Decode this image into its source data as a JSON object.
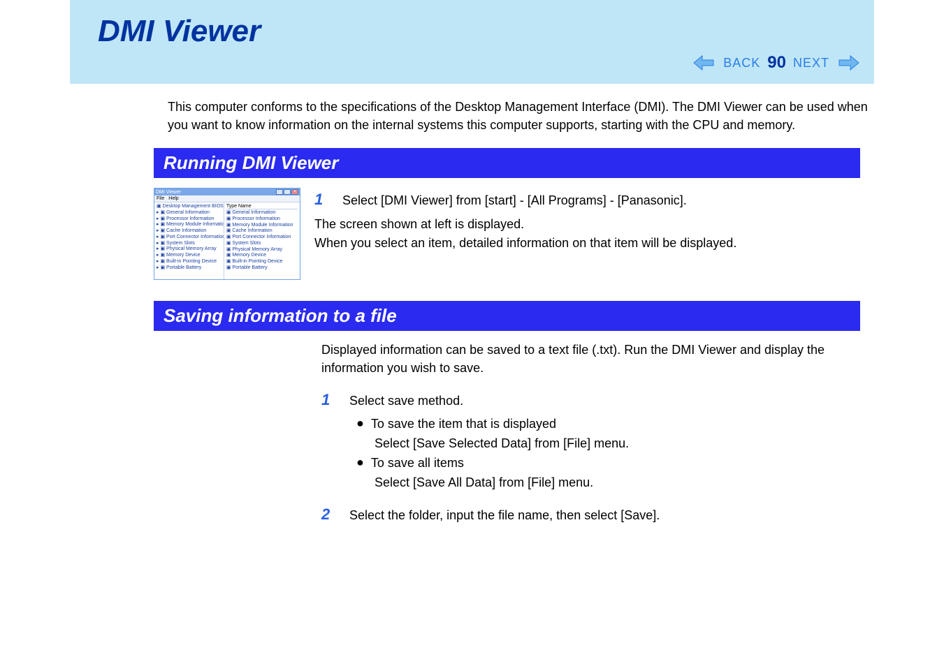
{
  "header": {
    "title": "DMI Viewer",
    "back_label": "BACK",
    "page_number": "90",
    "next_label": "NEXT"
  },
  "intro": "This computer conforms to the specifications of the Desktop Management Interface (DMI). The DMI Viewer can be used when you want to know information on the internal systems this computer supports, starting with the CPU and memory.",
  "section1": {
    "heading": "Running DMI Viewer",
    "step1_num": "1",
    "step1_text": "Select [DMI Viewer] from [start] - [All Programs] - [Panasonic].",
    "after1": "The screen shown at left is displayed.",
    "after2": "When you select an item, detailed information on that item will be displayed."
  },
  "thumb": {
    "title": "DMI Viewer",
    "menu_file": "File",
    "menu_help": "Help",
    "list_head": "Type Name",
    "tree": [
      "Desktop Management BIOS",
      "General Information",
      "Processor Information",
      "Memory Module Information",
      "Cache Information",
      "Port Connector Information",
      "System Slots",
      "Physical Memory Array",
      "Memory Device",
      "Built-in Pointing Device",
      "Portable Battery"
    ],
    "list": [
      "General Information",
      "Processor Information",
      "Memory Module Information",
      "Cache Information",
      "Port Connector Information",
      "System Slots",
      "Physical Memory Array",
      "Memory Device",
      "Built-in Pointing Device",
      "Portable Battery"
    ]
  },
  "section2": {
    "heading": "Saving information to a file",
    "intro": "Displayed information can be saved to a text file (.txt).  Run the DMI Viewer and display the information you wish to save.",
    "step1_num": "1",
    "step1_text": "Select save method.",
    "b1_head": "To save the item that is displayed",
    "b1_desc": "Select [Save Selected Data] from [File] menu.",
    "b2_head": "To save all items",
    "b2_desc": "Select [Save All Data] from [File] menu.",
    "step2_num": "2",
    "step2_text": "Select the folder, input the file name, then select [Save]."
  }
}
